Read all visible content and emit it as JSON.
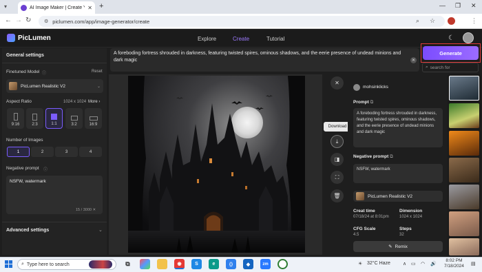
{
  "browser": {
    "tab_title": "AI Image Maker | Create Your F",
    "url": "piclumen.com/app/image-generator/create",
    "close_tab_glyph": "✕",
    "new_tab_glyph": "+"
  },
  "app": {
    "logo": "PicLumen",
    "nav": {
      "explore": "Explore",
      "create": "Create",
      "tutorial": "Tutorial"
    },
    "accent": "#7b4cff"
  },
  "sidebar": {
    "general_settings": "General settings",
    "finetuned_model": "Finetuned Model",
    "reset": "Reset",
    "model_name": "PicLumen Realistic V2",
    "aspect_ratio": "Aspect Ratio",
    "dimension": "1024 x 1024",
    "more": "More",
    "ratios": [
      "9:16",
      "2:3",
      "1:1",
      "3:2",
      "16:9"
    ],
    "selected_ratio": "1:1",
    "number_of_images": "Number of Images",
    "counts": [
      "1",
      "2",
      "3",
      "4"
    ],
    "negative_prompt_label": "Negative prompt",
    "negative_prompt_value": "NSFW, watermark",
    "char_count": "15 / 3000",
    "advanced_settings": "Advanced settings"
  },
  "prompt": {
    "text": "A foreboding fortress shrouded in darkness, featuring twisted spires, ominous shadows, and the eerie presence of undead minions and dark magic",
    "generate": "Generate",
    "search_placeholder": "search for"
  },
  "tooltip": {
    "download": "Download"
  },
  "detail": {
    "username": "mohsinklicks",
    "prompt_label": "Prompt",
    "prompt_text": "A foreboding fortress shrouded in darkness, featuring twisted spires, ominous shadows, and the eerie presence of undead minions and dark magic",
    "negative_label": "Negative prompt",
    "negative_text": "NSFW, watermark",
    "model": "PicLumen Realistic V2",
    "create_time_label": "Creat time",
    "create_time": "07/18/24 at 8:01pm",
    "dimension_label": "Dimension",
    "dimension": "1024 x 1024",
    "cfg_label": "CFG Scale",
    "cfg": "4.5",
    "steps_label": "Steps",
    "steps": "32",
    "remix": "Remix"
  },
  "taskbar": {
    "search_placeholder": "Type here to search",
    "weather": "32°C  Haze",
    "time": "8:02 PM",
    "date": "7/18/2024"
  }
}
